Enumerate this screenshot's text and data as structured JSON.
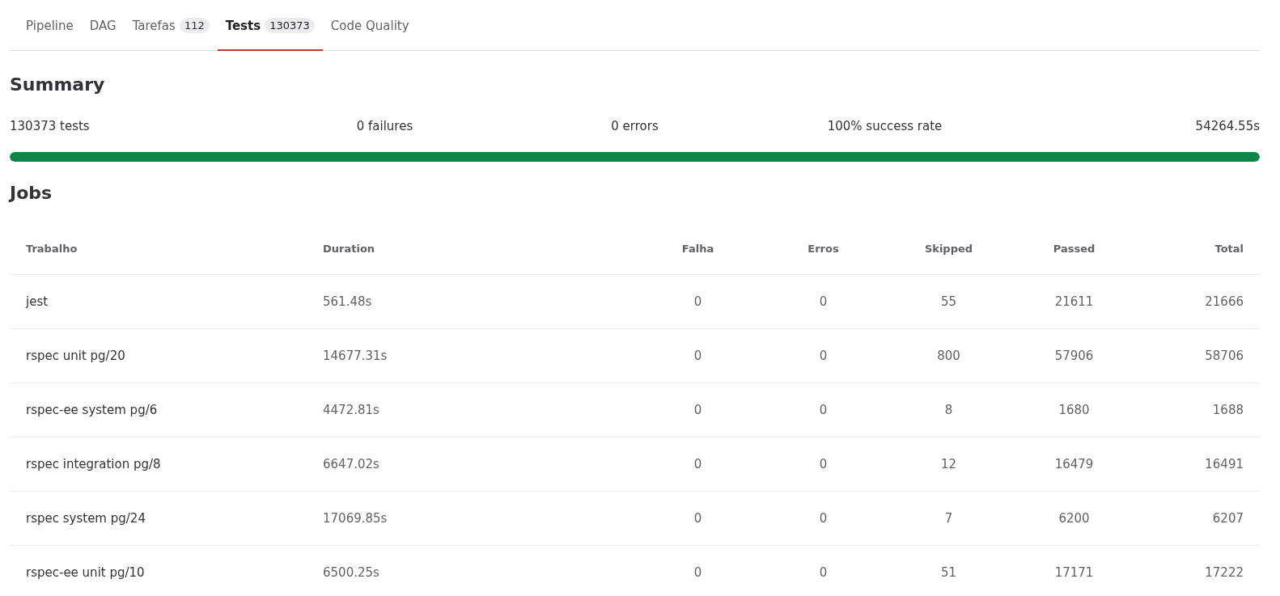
{
  "tabs": [
    {
      "label": "Pipeline",
      "selected": false
    },
    {
      "label": "DAG",
      "selected": false
    },
    {
      "label": "Tarefas",
      "count": "112",
      "selected": false
    },
    {
      "label": "Tests",
      "count": "130373",
      "selected": true
    },
    {
      "label": "Code Quality",
      "selected": false
    }
  ],
  "summary": {
    "title": "Summary",
    "stats": [
      "130373 tests",
      "0 failures",
      "0 errors",
      "100% success rate",
      "54264.55s"
    ],
    "level": 1
  },
  "jobs": {
    "title": "Jobs",
    "columns": [
      "Trabalho",
      "Duration",
      "Falha",
      "Erros",
      "Skipped",
      "Passed",
      "Total"
    ],
    "rows": [
      [
        "jest",
        "561.48s",
        "0",
        "0",
        "55",
        "21611",
        "21666"
      ],
      [
        "rspec unit pg/20",
        "14677.31s",
        "0",
        "0",
        "800",
        "57906",
        "58706"
      ],
      [
        "rspec-ee system pg/6",
        "4472.81s",
        "0",
        "0",
        "8",
        "1680",
        "1688"
      ],
      [
        "rspec integration pg/8",
        "6647.02s",
        "0",
        "0",
        "12",
        "16479",
        "16491"
      ],
      [
        "rspec system pg/24",
        "17069.85s",
        "0",
        "0",
        "7",
        "6200",
        "6207"
      ],
      [
        "rspec-ee unit pg/10",
        "6500.25s",
        "0",
        "0",
        "51",
        "17171",
        "17222"
      ]
    ]
  }
}
